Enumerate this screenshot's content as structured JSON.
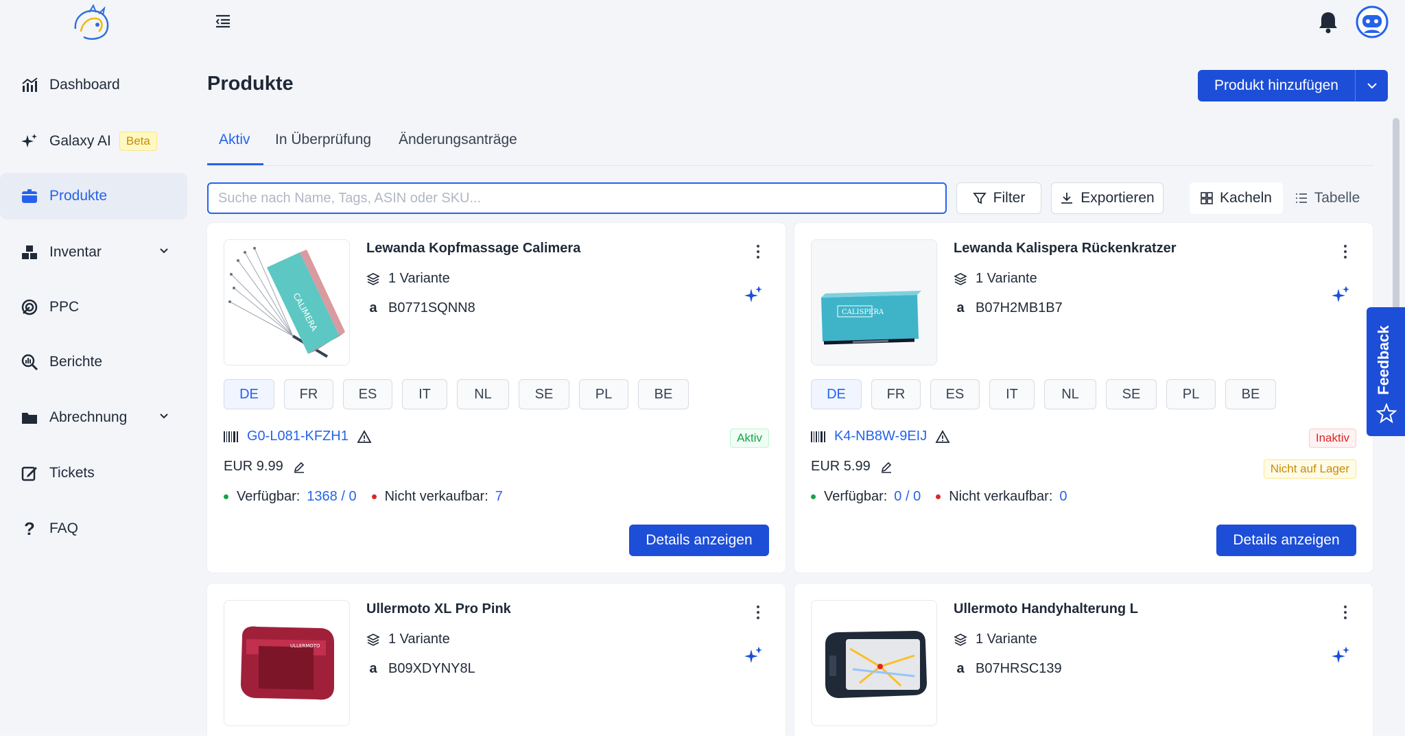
{
  "sidebar": {
    "items": [
      {
        "label": "Dashboard",
        "icon": "chart-icon"
      },
      {
        "label": "Galaxy AI",
        "icon": "sparkle-icon",
        "badge": "Beta"
      },
      {
        "label": "Produkte",
        "icon": "box-icon",
        "active": true
      },
      {
        "label": "Inventar",
        "icon": "boxes-icon",
        "expandable": true
      },
      {
        "label": "PPC",
        "icon": "target-icon"
      },
      {
        "label": "Berichte",
        "icon": "report-search-icon"
      },
      {
        "label": "Abrechnung",
        "icon": "folder-icon",
        "expandable": true
      },
      {
        "label": "Tickets",
        "icon": "edit-icon"
      },
      {
        "label": "FAQ",
        "icon": "question-icon"
      }
    ]
  },
  "header": {
    "title": "Produkte",
    "add_button": "Produkt hinzufügen"
  },
  "tabs": [
    {
      "label": "Aktiv",
      "active": true
    },
    {
      "label": "In Überprüfung"
    },
    {
      "label": "Änderungsanträge"
    }
  ],
  "toolbar": {
    "search_placeholder": "Suche nach Name, Tags, ASIN oder SKU...",
    "filter": "Filter",
    "export": "Exportieren",
    "tiles": "Kacheln",
    "table": "Tabelle"
  },
  "marketplaces": [
    "DE",
    "FR",
    "ES",
    "IT",
    "NL",
    "SE",
    "PL",
    "BE"
  ],
  "labels": {
    "available": "Verfügbar:",
    "unsellable": "Nicht verkaufbar:",
    "details": "Details anzeigen",
    "feedback": "Feedback"
  },
  "products": [
    {
      "name": "Lewanda Kopfmassage Calimera",
      "variants": "1 Variante",
      "asin": "B0771SQNN8",
      "sku": "G0-L081-KFZH1",
      "status": "Aktiv",
      "price": "EUR 9.99",
      "available": "1368 / 0",
      "unsellable": "7"
    },
    {
      "name": "Lewanda Kalispera Rückenkratzer",
      "variants": "1 Variante",
      "asin": "B07H2MB1B7",
      "sku": "K4-NB8W-9EIJ",
      "status": "Inaktiv",
      "status2": "Nicht auf Lager",
      "price": "EUR 5.99",
      "available": "0 / 0",
      "unsellable": "0"
    },
    {
      "name": "Ullermoto XL Pro Pink",
      "variants": "1 Variante",
      "asin": "B09XDYNY8L"
    },
    {
      "name": "Ullermoto Handyhalterung L",
      "variants": "1 Variante",
      "asin": "B07HRSC139"
    }
  ],
  "colors": {
    "accent": "#1d4ed8",
    "link": "#2563eb",
    "ok": "#16a34a",
    "danger": "#dc2626",
    "warning": "#ca8a04"
  }
}
